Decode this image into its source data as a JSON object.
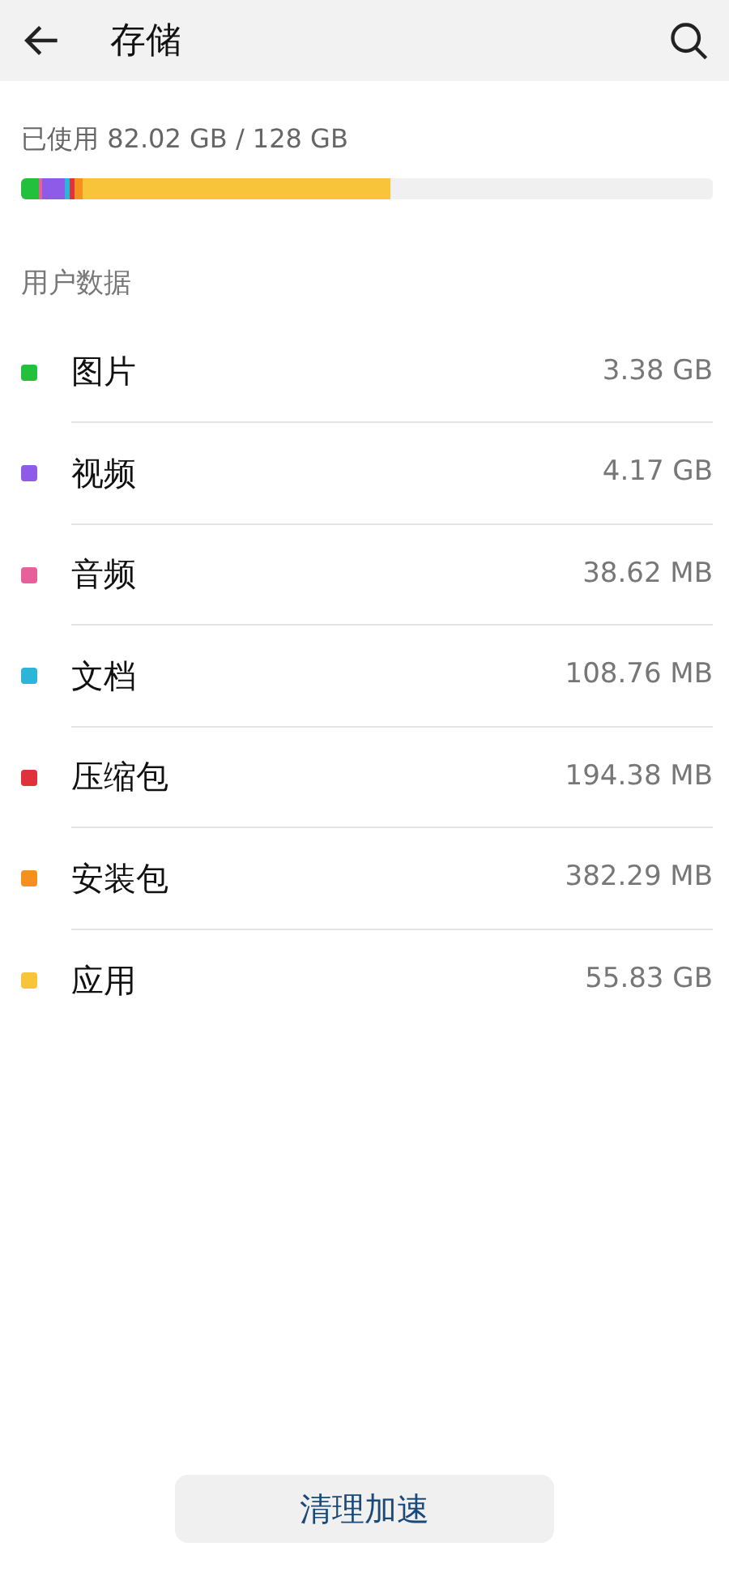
{
  "header": {
    "title": "存储"
  },
  "usage": {
    "text": "已使用 82.02 GB / 128 GB"
  },
  "section_title": "用户数据",
  "categories": [
    {
      "name": "图片",
      "size": "3.38 GB",
      "color": "#22c03c"
    },
    {
      "name": "视频",
      "size": "4.17 GB",
      "color": "#8e5be8"
    },
    {
      "name": "音频",
      "size": "38.62 MB",
      "color": "#e8609a"
    },
    {
      "name": "文档",
      "size": "108.76 MB",
      "color": "#2bb5d8"
    },
    {
      "name": "压缩包",
      "size": "194.38 MB",
      "color": "#e0323a"
    },
    {
      "name": "安装包",
      "size": "382.29 MB",
      "color": "#f5901e"
    },
    {
      "name": "应用",
      "size": "55.83 GB",
      "color": "#f8c53a"
    }
  ],
  "button": "清理加速"
}
